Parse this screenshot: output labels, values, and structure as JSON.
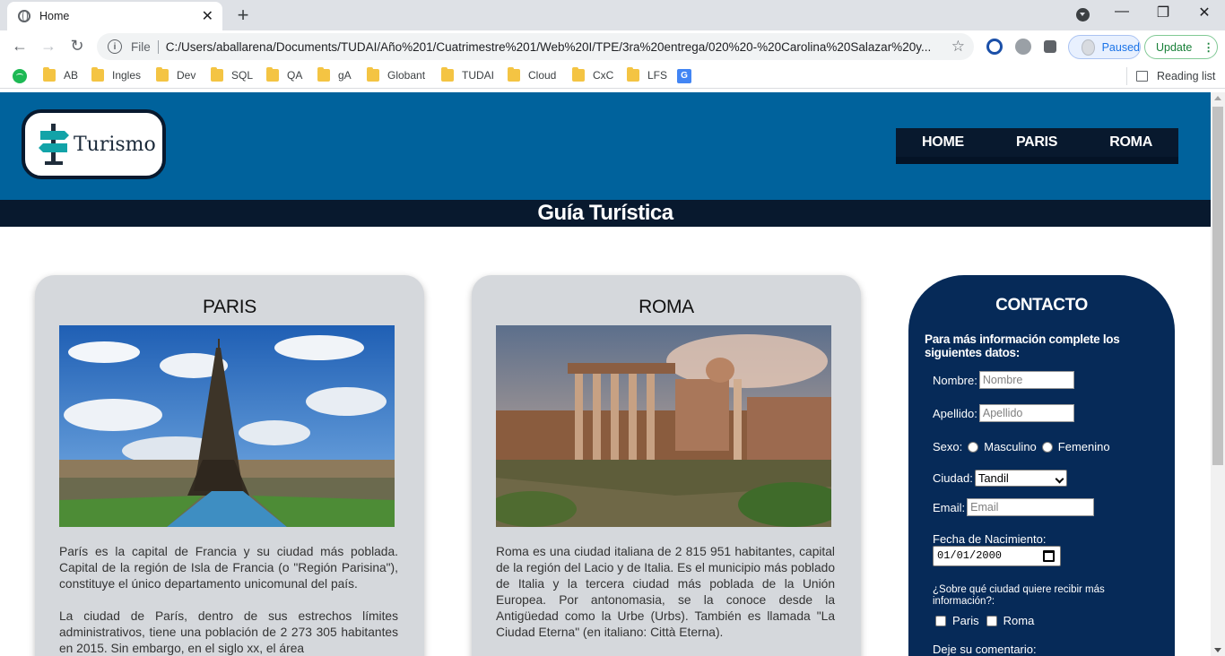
{
  "browser": {
    "tab_title": "Home",
    "address_scheme": "File",
    "address_url": "C:/Users/aballarena/Documents/TUDAI/Año%201/Cuatrimestre%201/Web%20I/TPE/3ra%20entrega/020%20-%20Carolina%20Salazar%20y...",
    "profile_status": "Paused",
    "update_label": "Update",
    "bookmarks": [
      "AB",
      "Ingles",
      "Dev",
      "SQL",
      "QA",
      "gA",
      "Globant",
      "TUDAI",
      "Cloud",
      "CxC",
      "LFS"
    ],
    "reading_list": "Reading list"
  },
  "site": {
    "logo_text": "Turismo",
    "nav": [
      "HOME",
      "PARIS",
      "ROMA"
    ],
    "subtitle": "Guía Turística"
  },
  "cards": [
    {
      "title": "PARIS",
      "paragraphs": [
        "París es la capital de Francia y su ciudad más poblada. Capital de la región de Isla de Francia (o \"Región Parisina\"), constituye el único departamento unicomunal del país.",
        "La ciudad de París, dentro de sus estrechos límites administrativos, tiene una población de 2 273 305 habitantes en 2015. Sin embargo, en el siglo xx, el área"
      ]
    },
    {
      "title": "ROMA",
      "paragraphs": [
        "Roma es una ciudad italiana de 2 815 951 habitantes, capital de la región del Lacio y de Italia. Es el municipio más poblado de Italia y la tercera ciudad más poblada de la Unión Europea. Por antonomasia, se la conoce desde la Antigüedad como la Urbe (Urbs). También es llamada \"La Ciudad Eterna\" (en italiano: Città Eterna)."
      ]
    }
  ],
  "contact": {
    "title": "CONTACTO",
    "intro": "Para más información complete los siguientes datos:",
    "nombre_label": "Nombre:",
    "nombre_placeholder": "Nombre",
    "apellido_label": "Apellido:",
    "apellido_placeholder": "Apellido",
    "sexo_label": "Sexo:",
    "sexo_options": [
      "Masculino",
      "Femenino"
    ],
    "ciudad_label": "Ciudad:",
    "ciudad_value": "Tandil",
    "email_label": "Email:",
    "email_placeholder": "Email",
    "fecha_label": "Fecha de Nacimiento:",
    "fecha_value": "01/01/2000",
    "interest_question": "¿Sobre qué ciudad quiere recibir más información?:",
    "interest_options": [
      "Paris",
      "Roma"
    ],
    "comment_label": "Deje su comentario:"
  },
  "colors": {
    "header_blue": "#00629c",
    "dark_navy": "#08192e",
    "contact_navy": "#062a58",
    "card_gray": "#d5d8dc"
  }
}
